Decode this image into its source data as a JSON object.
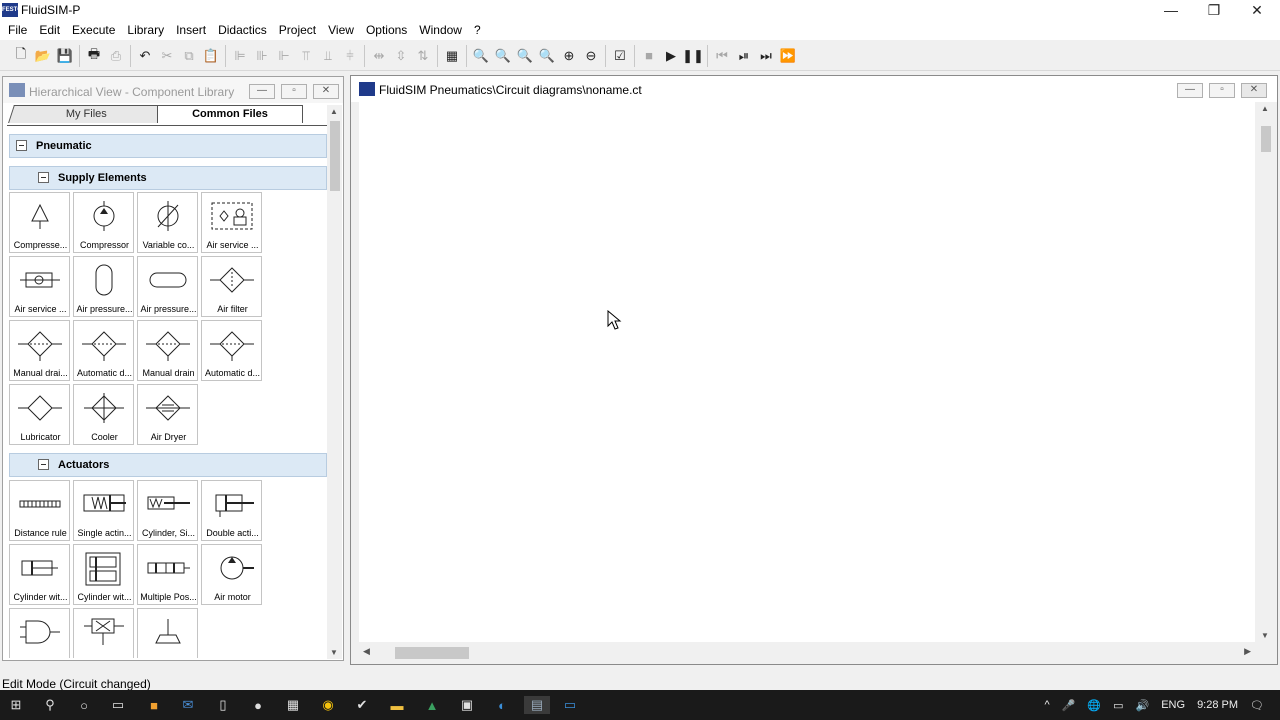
{
  "app": {
    "title": "FluidSIM-P",
    "icon_text": "FESTO"
  },
  "window_controls": {
    "minimize": "—",
    "restore": "❐",
    "close": "✕"
  },
  "menu": [
    "File",
    "Edit",
    "Execute",
    "Library",
    "Insert",
    "Didactics",
    "Project",
    "View",
    "Options",
    "Window",
    "?"
  ],
  "toolbar": {
    "buttons": [
      "new-icon",
      "open-icon",
      "save-icon",
      "print-preview-icon",
      "print-icon",
      "undo-icon",
      "cut-icon",
      "copy-icon",
      "paste-icon",
      "align-left-icon",
      "align-center-icon",
      "align-right-icon",
      "align-top-icon",
      "align-middle-icon",
      "align-bottom-icon",
      "distribute-h-icon",
      "distribute-v-icon",
      "grid-icon",
      "zoom-1-icon",
      "zoom-fit-icon",
      "zoom-window-icon",
      "zoom-region-icon",
      "zoom-in-icon",
      "zoom-out-icon",
      "check-icon",
      "stop-icon",
      "play-icon",
      "pause-icon",
      "reset-icon",
      "step-icon",
      "next-icon",
      "fast-forward-icon"
    ]
  },
  "library_window": {
    "title": "Hierarchical View - Component Library",
    "tabs": [
      "My Files",
      "Common Files"
    ],
    "active_tab": "Common Files",
    "sections": [
      {
        "label": "Pneumatic"
      },
      {
        "label": "Supply Elements",
        "items": [
          "Compresse...",
          "Compressor",
          "Variable co...",
          "Air service ...",
          "Air service ...",
          "Air pressure...",
          "Air pressure...",
          "Air filter",
          "Manual drai...",
          "Automatic d...",
          "Manual drain",
          "Automatic d...",
          "Lubricator",
          "Cooler",
          "Air Dryer"
        ]
      },
      {
        "label": "Actuators",
        "items": [
          "Distance rule",
          "Single actin...",
          "Cylinder, Si...",
          "Double acti...",
          "Cylinder wit...",
          "Cylinder wit...",
          "Multiple Pos...",
          "Air motor",
          "",
          "",
          ""
        ]
      }
    ]
  },
  "circuit_window": {
    "title": "FluidSIM Pneumatics\\Circuit diagrams\\noname.ct"
  },
  "status": "Edit Mode (Circuit changed)",
  "taskbar": {
    "language": "ENG",
    "time": "9:28 PM"
  }
}
